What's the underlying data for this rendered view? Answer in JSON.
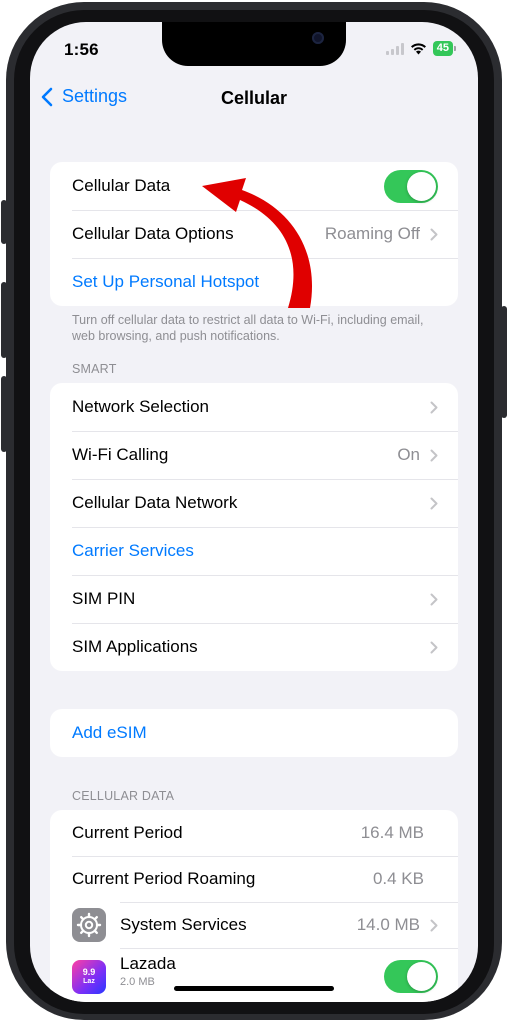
{
  "status_bar": {
    "time": "1:56",
    "battery": "45"
  },
  "nav": {
    "back_label": "Settings",
    "title": "Cellular"
  },
  "group1": {
    "cellular_data_label": "Cellular Data",
    "cellular_data_on": true,
    "options_label": "Cellular Data Options",
    "options_value": "Roaming Off",
    "hotspot_label": "Set Up Personal Hotspot"
  },
  "group1_footer": "Turn off cellular data to restrict all data to Wi-Fi, including email, web browsing, and push notifications.",
  "smart": {
    "header": "SMART",
    "items": [
      {
        "label": "Network Selection",
        "value": ""
      },
      {
        "label": "Wi-Fi Calling",
        "value": "On"
      },
      {
        "label": "Cellular Data Network",
        "value": ""
      },
      {
        "label": "Carrier Services",
        "value": ""
      },
      {
        "label": "SIM PIN",
        "value": ""
      },
      {
        "label": "SIM Applications",
        "value": ""
      }
    ]
  },
  "esim": {
    "label": "Add eSIM"
  },
  "cellular_data": {
    "header": "CELLULAR DATA",
    "current_period_label": "Current Period",
    "current_period_value": "16.4 MB",
    "roaming_label": "Current Period Roaming",
    "roaming_value": "0.4 KB",
    "apps": [
      {
        "name": "System Services",
        "value": "14.0 MB",
        "icon": "gear-icon"
      },
      {
        "name": "Lazada",
        "usage": "2.0 MB",
        "icon": "lazada-app-icon",
        "icon_text": "9.9",
        "icon_subtext": "Laz",
        "enabled": true
      }
    ]
  },
  "colors": {
    "accent": "#007aff",
    "toggle_on": "#34c759",
    "annotation_arrow": "#e00000"
  }
}
